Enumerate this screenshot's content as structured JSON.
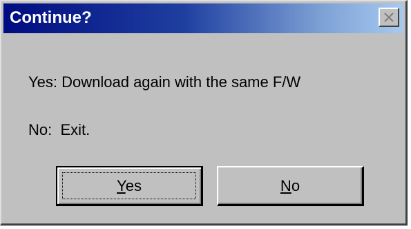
{
  "dialog": {
    "title": "Continue?",
    "close_icon": "close-icon",
    "message_yes": "Yes: Download again with the same F/W",
    "message_no": "No:  Exit.",
    "buttons": {
      "yes": {
        "mnemonic": "Y",
        "rest": "es"
      },
      "no": {
        "mnemonic": "N",
        "rest": "o"
      }
    },
    "colors": {
      "titlebar_start": "#000c80",
      "titlebar_end": "#a6caf0",
      "face": "#c0c0c0"
    }
  }
}
